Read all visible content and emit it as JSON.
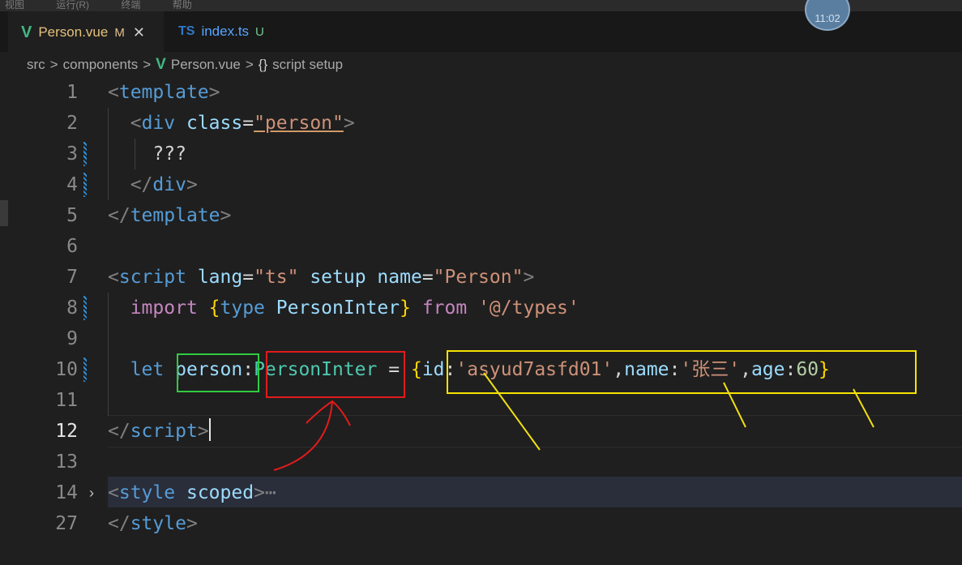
{
  "top_strip": [
    "视图",
    "运行(R)",
    "终端",
    "帮助"
  ],
  "clock": "11:02",
  "tabs": [
    {
      "label": "Person.vue",
      "status": "M",
      "close": "✕"
    },
    {
      "label": "index.ts",
      "status": "U",
      "logo": "TS"
    }
  ],
  "breadcrumb": {
    "p1": "src",
    "p2": "components",
    "p3": "Person.vue",
    "p4": "script setup",
    "sep": ">",
    "brace": "{}"
  },
  "line_numbers": [
    "1",
    "2",
    "3",
    "4",
    "5",
    "6",
    "7",
    "8",
    "9",
    "10",
    "11",
    "12",
    "13",
    "14",
    "27"
  ],
  "code": {
    "l1_tag": "template",
    "l2_tag": "div",
    "l2_attr": "class",
    "l2_val": "\"person\"",
    "l3_text": "???",
    "l4_tag": "div",
    "l5_tag": "template",
    "l7_tag": "script",
    "l7_a1": "lang",
    "l7_v1": "\"ts\"",
    "l7_a2": "setup",
    "l7_a3": "name",
    "l7_v3": "\"Person\"",
    "l8_import": "import",
    "l8_type": "type",
    "l8_name": "PersonInter",
    "l8_from": "from",
    "l8_path": "'@/types'",
    "l10_let": "let",
    "l10_var": "person",
    "l10_type": "PersonInter",
    "l10_eq": "=",
    "l10_k1": "id",
    "l10_v1": "'asyud7asfd01'",
    "l10_k2": "name",
    "l10_v2": "'张三'",
    "l10_k3": "age",
    "l10_v3": "60",
    "l12_tag": "script",
    "l14_tag": "style",
    "l14_attr": "scoped",
    "l14_fold": "⋯",
    "l27_tag": "style"
  }
}
